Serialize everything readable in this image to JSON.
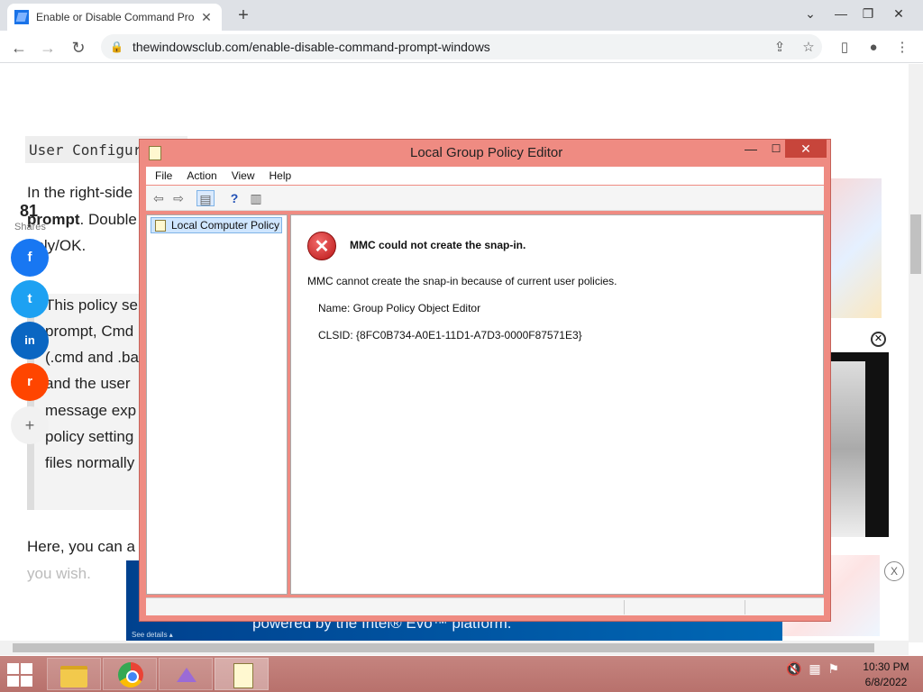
{
  "browser": {
    "tab_title": "Enable or Disable Command Pro",
    "new_tab": "+",
    "url": "thewindowsclub.com/enable-disable-command-prompt-windows",
    "tab_close": "✕"
  },
  "article": {
    "code_line": "User Configur",
    "para1_line1": "In the right-side",
    "para1_line2_bold": "prompt",
    "para1_line2_rest": ". Double",
    "para1_line3": "pply/OK.",
    "quote_lines": [
      "This policy se",
      "prompt, Cmd",
      "(.cmd and .ba",
      "and the user",
      "message exp",
      "policy setting",
      "files normally"
    ],
    "para2_line1": "Here, you can a",
    "para2_line2": "you wish."
  },
  "shares": {
    "count": "81",
    "label": "Shares",
    "facebook": "f",
    "twitter": "t",
    "linkedin": "in",
    "reddit": "r",
    "more": "+"
  },
  "ads": {
    "banner_text": "powered by the Intel® Evo™ platform.",
    "see_details": "See details ▴",
    "close_x": "X",
    "close_small": "✕"
  },
  "mmc": {
    "title": "Local Group Policy Editor",
    "menu": [
      "File",
      "Action",
      "View",
      "Help"
    ],
    "tree_root": "Local Computer Policy",
    "error_title": "MMC could not create the snap-in.",
    "error_message": "MMC cannot create the snap-in because of current user policies.",
    "error_name": "Name: Group Policy Object Editor",
    "error_clsid": "CLSID: {8FC0B734-A0E1-11D1-A7D3-0000F87571E3}"
  },
  "taskbar": {
    "time": "10:30 PM",
    "date": "6/8/2022"
  },
  "colors": {
    "facebook": "#1877f2",
    "twitter": "#1da1f2",
    "linkedin": "#0a66c2",
    "reddit": "#ff4500",
    "mmc_frame": "#ef8b82"
  }
}
